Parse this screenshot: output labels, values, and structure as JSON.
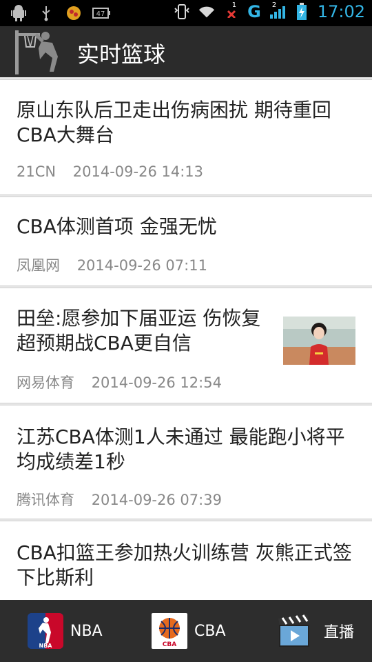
{
  "status_bar": {
    "icons_left": [
      "android-debug-icon",
      "usb-icon",
      "app-notification-icon",
      "battery-47-icon"
    ],
    "battery_badge": "47",
    "network_type": "G",
    "sim_indicator": "1",
    "signal_indicator": "2",
    "time": "17:02"
  },
  "header": {
    "title": "实时篮球"
  },
  "news": [
    {
      "title": "原山东队后卫走出伤病困扰 期待重回CBA大舞台",
      "source": "21CN",
      "datetime": "2014-09-26 14:13",
      "has_thumbnail": false
    },
    {
      "title": "CBA体测首项 金强无忧",
      "source": "凤凰网",
      "datetime": "2014-09-26 07:11",
      "has_thumbnail": false
    },
    {
      "title": "田垒:愿参加下届亚运 伤恢复超预期战CBA更自信",
      "source": "网易体育",
      "datetime": "2014-09-26 12:54",
      "has_thumbnail": true
    },
    {
      "title": "江苏CBA体测1人未通过 最能跑小将平均成绩差1秒",
      "source": "腾讯体育",
      "datetime": "2014-09-26 07:39",
      "has_thumbnail": false
    },
    {
      "title": "CBA扣篮王参加热火训练营 灰熊正式签下比斯利",
      "source": "",
      "datetime": "",
      "has_thumbnail": false
    }
  ],
  "bottom_nav": {
    "tabs": [
      {
        "label": "NBA",
        "icon": "nba-logo-icon"
      },
      {
        "label": "CBA",
        "icon": "cba-logo-icon"
      },
      {
        "label": "直播",
        "icon": "clapperboard-icon"
      }
    ]
  },
  "colors": {
    "status_accent": "#33b5e5",
    "action_bar_bg": "#2b2b2b",
    "bottom_bar_bg": "#2d2d2d",
    "list_bg": "#e6e6e6"
  }
}
